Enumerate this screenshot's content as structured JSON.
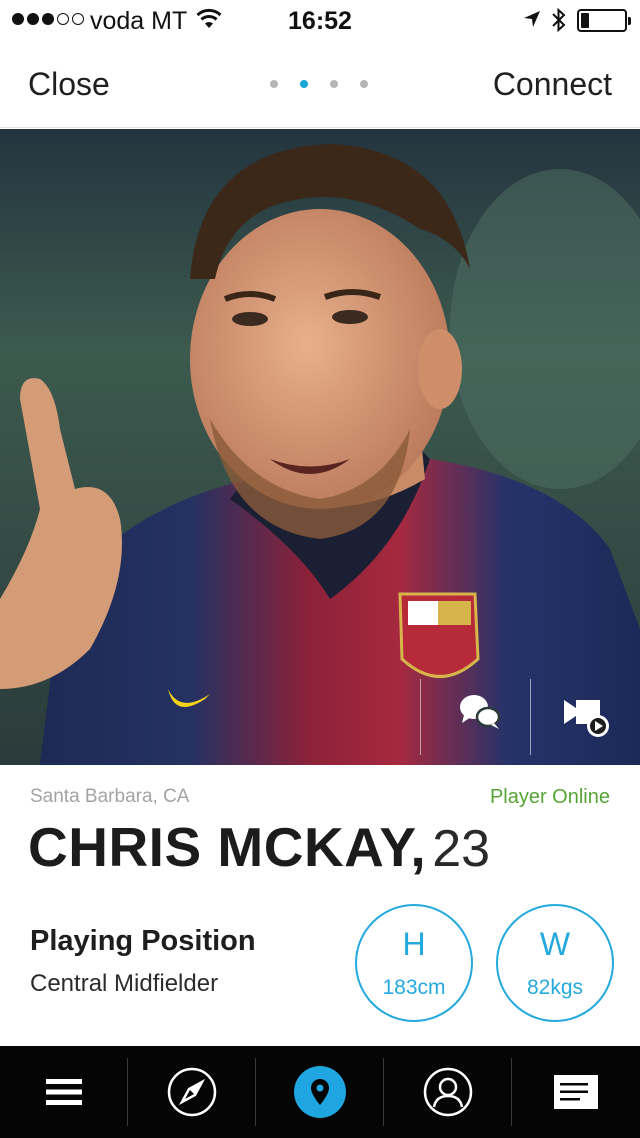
{
  "status_bar": {
    "signal_bars_filled": 3,
    "signal_bars_total": 5,
    "carrier": "voda MT",
    "time": "16:52",
    "battery_level": 0.2
  },
  "nav": {
    "close_label": "Close",
    "connect_label": "Connect",
    "pager_total": 4,
    "pager_active_index": 1
  },
  "hero": {
    "photo_icon": "player-photo",
    "chat_icon": "chat-bubbles-icon",
    "video_icon": "video-camera-icon"
  },
  "profile": {
    "location": "Santa Barbara, CA",
    "status": "Player Online",
    "name": "CHRIS MCKAY,",
    "age": "23",
    "position_title": "Playing Position",
    "position_value": "Central Midfielder",
    "height_letter": "H",
    "height_value": "183cm",
    "weight_letter": "W",
    "weight_value": "82kgs"
  },
  "tab_bar": {
    "items": [
      {
        "icon": "menu-icon"
      },
      {
        "icon": "compass-icon"
      },
      {
        "icon": "location-pin-icon",
        "active": true
      },
      {
        "icon": "profile-icon"
      },
      {
        "icon": "notes-icon"
      }
    ]
  },
  "colors": {
    "accent": "#24a9de",
    "online": "#56a536",
    "tab_bar": "#050505"
  }
}
